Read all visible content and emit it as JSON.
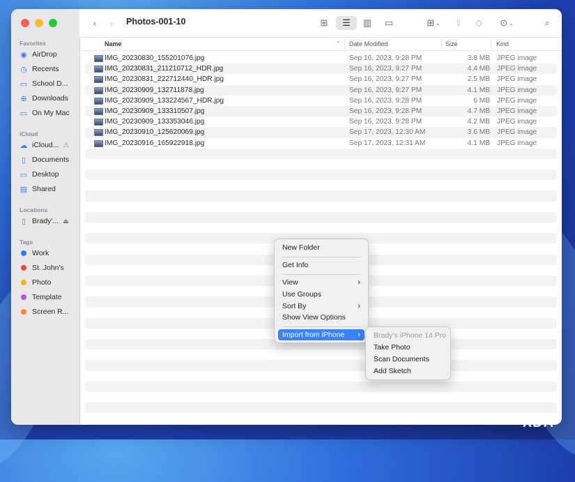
{
  "window": {
    "title": "Photos-001-10"
  },
  "sidebar": {
    "favorites_header": "Favorites",
    "favorites": [
      {
        "label": "AirDrop",
        "icon": "airdrop-icon"
      },
      {
        "label": "Recents",
        "icon": "clock-icon"
      },
      {
        "label": "School D...",
        "icon": "folder-icon"
      },
      {
        "label": "Downloads",
        "icon": "download-icon"
      },
      {
        "label": "On My Mac",
        "icon": "folder-icon"
      }
    ],
    "icloud_header": "iCloud",
    "icloud": [
      {
        "label": "iCloud...",
        "icon": "cloud-icon"
      },
      {
        "label": "Documents",
        "icon": "document-icon"
      },
      {
        "label": "Desktop",
        "icon": "desktop-icon"
      },
      {
        "label": "Shared",
        "icon": "shared-folder-icon"
      }
    ],
    "locations_header": "Locations",
    "locations": [
      {
        "label": "Brady'...",
        "icon": "iphone-icon"
      }
    ],
    "tags_header": "Tags",
    "tags": [
      {
        "label": "Work",
        "color": "#2f7cf6"
      },
      {
        "label": "St. John's",
        "color": "#f0473c"
      },
      {
        "label": "Photo",
        "color": "#f7b500"
      },
      {
        "label": "Template",
        "color": "#b05cd6"
      },
      {
        "label": "Screen R...",
        "color": "#ff8a1f"
      }
    ]
  },
  "columns": {
    "name": "Name",
    "date": "Date Modified",
    "size": "Size",
    "kind": "Kind"
  },
  "files": [
    {
      "name": "IMG_20230830_155201076.jpg",
      "date": "Sep 16, 2023, 9:28 PM",
      "size": "3.8 MB",
      "kind": "JPEG image"
    },
    {
      "name": "IMG_20230831_211210712_HDR.jpg",
      "date": "Sep 16, 2023, 9:27 PM",
      "size": "4.4 MB",
      "kind": "JPEG image"
    },
    {
      "name": "IMG_20230831_222712440_HDR.jpg",
      "date": "Sep 16, 2023, 9:27 PM",
      "size": "2.5 MB",
      "kind": "JPEG image"
    },
    {
      "name": "IMG_20230909_132711878.jpg",
      "date": "Sep 16, 2023, 9:27 PM",
      "size": "4.1 MB",
      "kind": "JPEG image"
    },
    {
      "name": "IMG_20230909_133224567_HDR.jpg",
      "date": "Sep 16, 2023, 9:28 PM",
      "size": "6 MB",
      "kind": "JPEG image"
    },
    {
      "name": "IMG_20230909_133310507.jpg",
      "date": "Sep 16, 2023, 9:28 PM",
      "size": "4.7 MB",
      "kind": "JPEG image"
    },
    {
      "name": "IMG_20230909_133353046.jpg",
      "date": "Sep 16, 2023, 9:28 PM",
      "size": "4.2 MB",
      "kind": "JPEG image"
    },
    {
      "name": "IMG_20230910_125620069.jpg",
      "date": "Sep 17, 2023, 12:30 AM",
      "size": "3.6 MB",
      "kind": "JPEG image"
    },
    {
      "name": "IMG_20230916_165922918.jpg",
      "date": "Sep 17, 2023, 12:31 AM",
      "size": "4.1 MB",
      "kind": "JPEG image"
    }
  ],
  "context_menu": {
    "new_folder": "New Folder",
    "get_info": "Get Info",
    "view": "View",
    "use_groups": "Use Groups",
    "sort_by": "Sort By",
    "show_view_options": "Show View Options",
    "import_from_iphone": "Import from iPhone"
  },
  "submenu": {
    "device": "Brady's iPhone 14 Pro",
    "take_photo": "Take Photo",
    "scan_documents": "Scan Documents",
    "add_sketch": "Add Sketch"
  },
  "watermark": "XDA"
}
